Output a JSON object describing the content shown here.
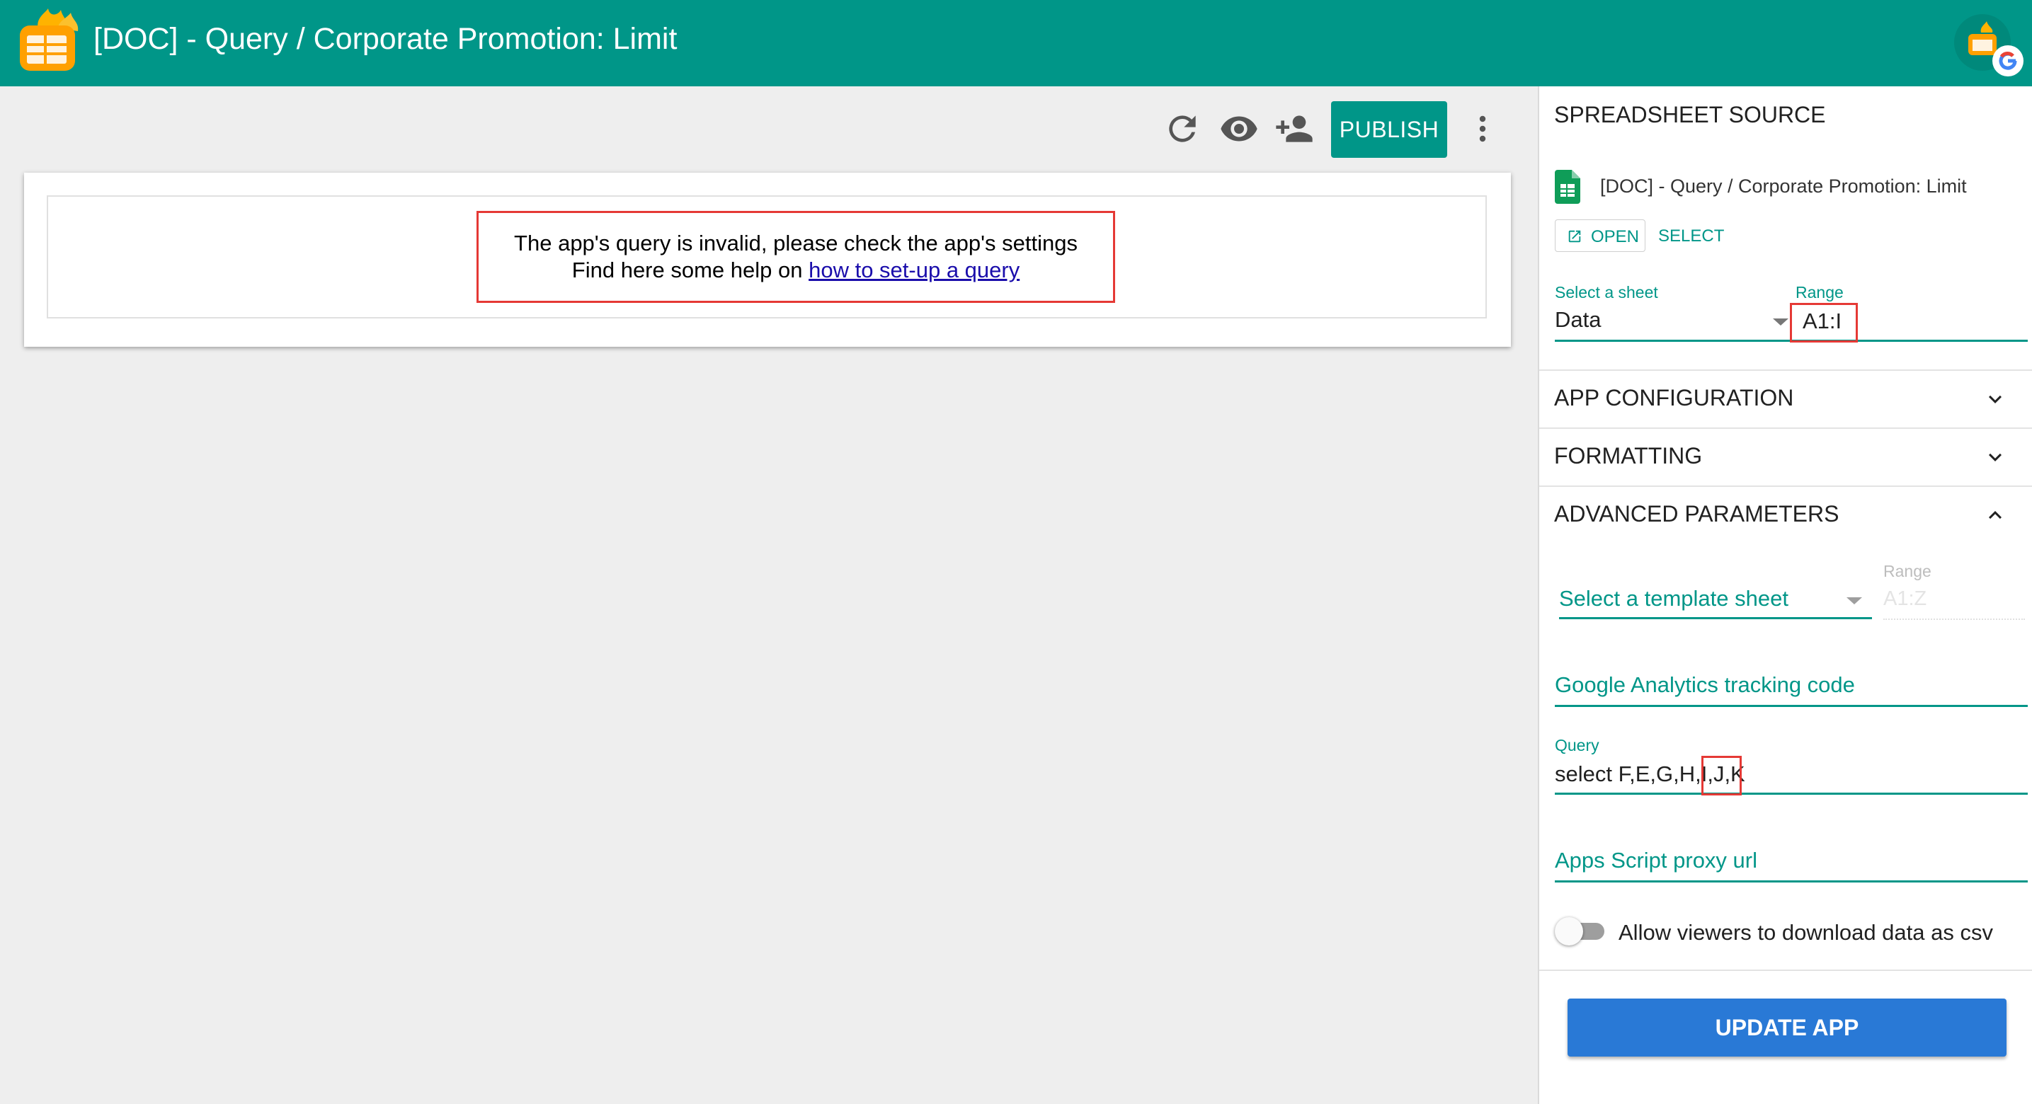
{
  "header": {
    "title": "[DOC] - Query / Corporate Promotion: Limit",
    "logo_icon": "spreadsheet-flame-logo-icon",
    "account_icon": "google-account-icon",
    "bar_color": "#009688"
  },
  "toolbar": {
    "refresh_icon": "refresh-icon",
    "preview_icon": "eye-icon",
    "share_icon": "add-people-icon",
    "publish_label": "PUBLISH",
    "more_icon": "more-vert-icon"
  },
  "preview": {
    "error_line1": "The app's query is invalid, please check the app's settings",
    "help_prefix": "Find here some help on ",
    "help_link": "how to set-up a query"
  },
  "panel": {
    "source": {
      "title": "SPREADSHEET SOURCE",
      "file_name": "[DOC] - Query / Corporate Promotion: Limit",
      "file_icon": "google-sheets-icon",
      "open_label": "OPEN",
      "select_label": "SELECT",
      "sheet_label": "Select a sheet",
      "sheet_value": "Data",
      "range_label": "Range",
      "range_value": "A1:I"
    },
    "sections": {
      "app_config": "APP CONFIGURATION",
      "formatting": "FORMATTING",
      "advanced": "ADVANCED PARAMETERS"
    },
    "advanced": {
      "template_placeholder": "Select a template sheet",
      "template_range_label": "Range",
      "template_range_value": "A1:Z",
      "ga_placeholder": "Google Analytics tracking code",
      "query_label": "Query",
      "query_value": "select F,E,G,H,I,J,K",
      "proxy_placeholder": "Apps Script proxy url",
      "csv_toggle_label": "Allow viewers to download data as csv",
      "csv_toggle_on": false
    },
    "update_label": "UPDATE APP"
  },
  "colors": {
    "accent": "#009688",
    "highlight": "#e53935",
    "update_button": "#2979d6"
  }
}
